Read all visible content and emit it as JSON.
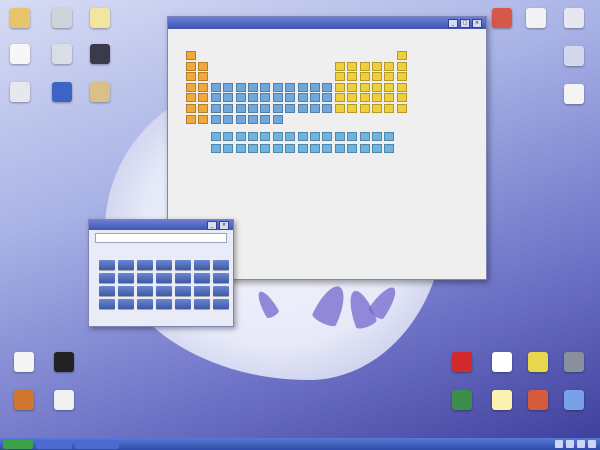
{
  "desktop": {
    "icons_left": [
      {
        "name": "home-folder-icon",
        "label": "",
        "color": "#e8c46a"
      },
      {
        "name": "network-icon",
        "label": "",
        "color": "#cfd3da"
      },
      {
        "name": "notepad-icon",
        "label": "",
        "color": "#f3e4a0"
      },
      {
        "name": "document-icon",
        "label": "",
        "color": "#f7f7f7"
      },
      {
        "name": "window-icon",
        "label": "",
        "color": "#d9dde8"
      },
      {
        "name": "terminal-icon",
        "label": "",
        "color": "#3a3a4a"
      },
      {
        "name": "printer-icon",
        "label": "",
        "color": "#e7e7ee"
      },
      {
        "name": "flag-icon",
        "label": "",
        "color": "#3d64c4"
      },
      {
        "name": "search-folder-icon",
        "label": "",
        "color": "#d9c089"
      }
    ],
    "icons_right_top": [
      {
        "name": "tool-icon",
        "color": "#d6584a"
      },
      {
        "name": "monitor-icon",
        "color": "#f2f2f5"
      },
      {
        "name": "screen-icon",
        "color": "#e7e7f1"
      },
      {
        "name": "disk-icon",
        "color": "#d3d8ee"
      },
      {
        "name": "page-icon",
        "color": "#f4f4f4"
      }
    ],
    "icons_bottom_left": [
      {
        "name": "disc-icon",
        "color": "#f4f4f4"
      },
      {
        "name": "display-icon",
        "color": "#222222"
      },
      {
        "name": "book-icon",
        "color": "#d0772f"
      },
      {
        "name": "headset-icon",
        "color": "#f0f0f4"
      }
    ],
    "icons_bottom_right": [
      {
        "name": "red-pill-icon",
        "color": "#d22a2a"
      },
      {
        "name": "dots-icon",
        "color": "#ffffff"
      },
      {
        "name": "smiley-icon",
        "color": "#e9d64a"
      },
      {
        "name": "chart-icon",
        "color": "#8a8f9c"
      },
      {
        "name": "spreadsheet-icon",
        "color": "#3d8e4b"
      },
      {
        "name": "bulb-icon",
        "color": "#fbf2b0"
      },
      {
        "name": "grid-icon",
        "color": "#d65a3c"
      },
      {
        "name": "star-icon",
        "color": "#7aa0e8"
      }
    ]
  },
  "periodic_window": {
    "title": "",
    "colors": {
      "s_block": "#f0a93a",
      "p_block": "#efcf3a",
      "d_block": "#6fa8dc",
      "f_block": "#6fb4e0"
    },
    "properties": [
      {
        "key": "",
        "value": ""
      },
      {
        "key": "",
        "value": ""
      },
      {
        "key": "",
        "value": ""
      },
      {
        "key": "",
        "value": ""
      },
      {
        "key": "",
        "value": ""
      },
      {
        "key": "",
        "value": ""
      },
      {
        "key": "",
        "value": ""
      },
      {
        "key": "",
        "value": ""
      },
      {
        "key": "",
        "value": ""
      },
      {
        "key": "",
        "value": ""
      },
      {
        "key": "",
        "value": ""
      },
      {
        "key": "",
        "value": ""
      }
    ]
  },
  "calculator": {
    "title": "",
    "display": "",
    "keys": [
      "",
      "",
      "",
      "",
      "",
      "",
      "",
      "",
      "",
      "",
      "",
      "",
      "",
      "",
      "",
      "",
      "",
      "",
      "",
      "",
      "",
      "",
      "",
      "",
      "",
      "",
      "",
      ""
    ]
  },
  "taskbar": {
    "start_label": "",
    "buttons": [
      "",
      ""
    ]
  }
}
